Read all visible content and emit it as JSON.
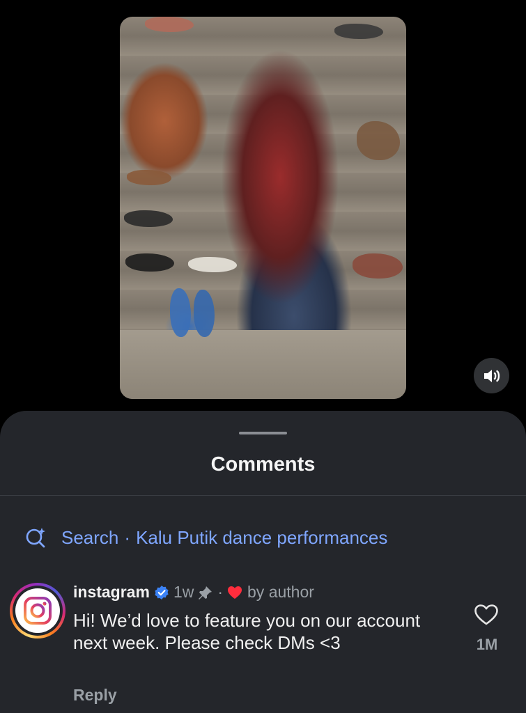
{
  "video": {
    "mute_icon": "speaker-icon"
  },
  "comments_sheet": {
    "title": "Comments",
    "search": {
      "label": "Search",
      "separator": "·",
      "query": "Kalu Putik dance performances",
      "icon": "search-sparkle-icon"
    },
    "comment": {
      "username": "instagram",
      "verified_icon": "verified-badge-icon",
      "time": "1w",
      "pin_icon": "pin-icon",
      "dot": "·",
      "author_like_icon": "red-heart-icon",
      "author_like_text": "by author",
      "text": "Hi! We’d love to feature you on our account next week. Please check DMs <3",
      "reply_label": "Reply",
      "like_icon": "heart-outline-icon",
      "like_count": "1M",
      "avatar": "instagram-logo"
    }
  },
  "colors": {
    "background": "#000000",
    "sheet": "#24262b",
    "link_blue": "#7fa6ff",
    "verified_blue": "#3b82f6",
    "heart_red": "#ff2d3d",
    "muted_text": "#9aa0a6"
  }
}
